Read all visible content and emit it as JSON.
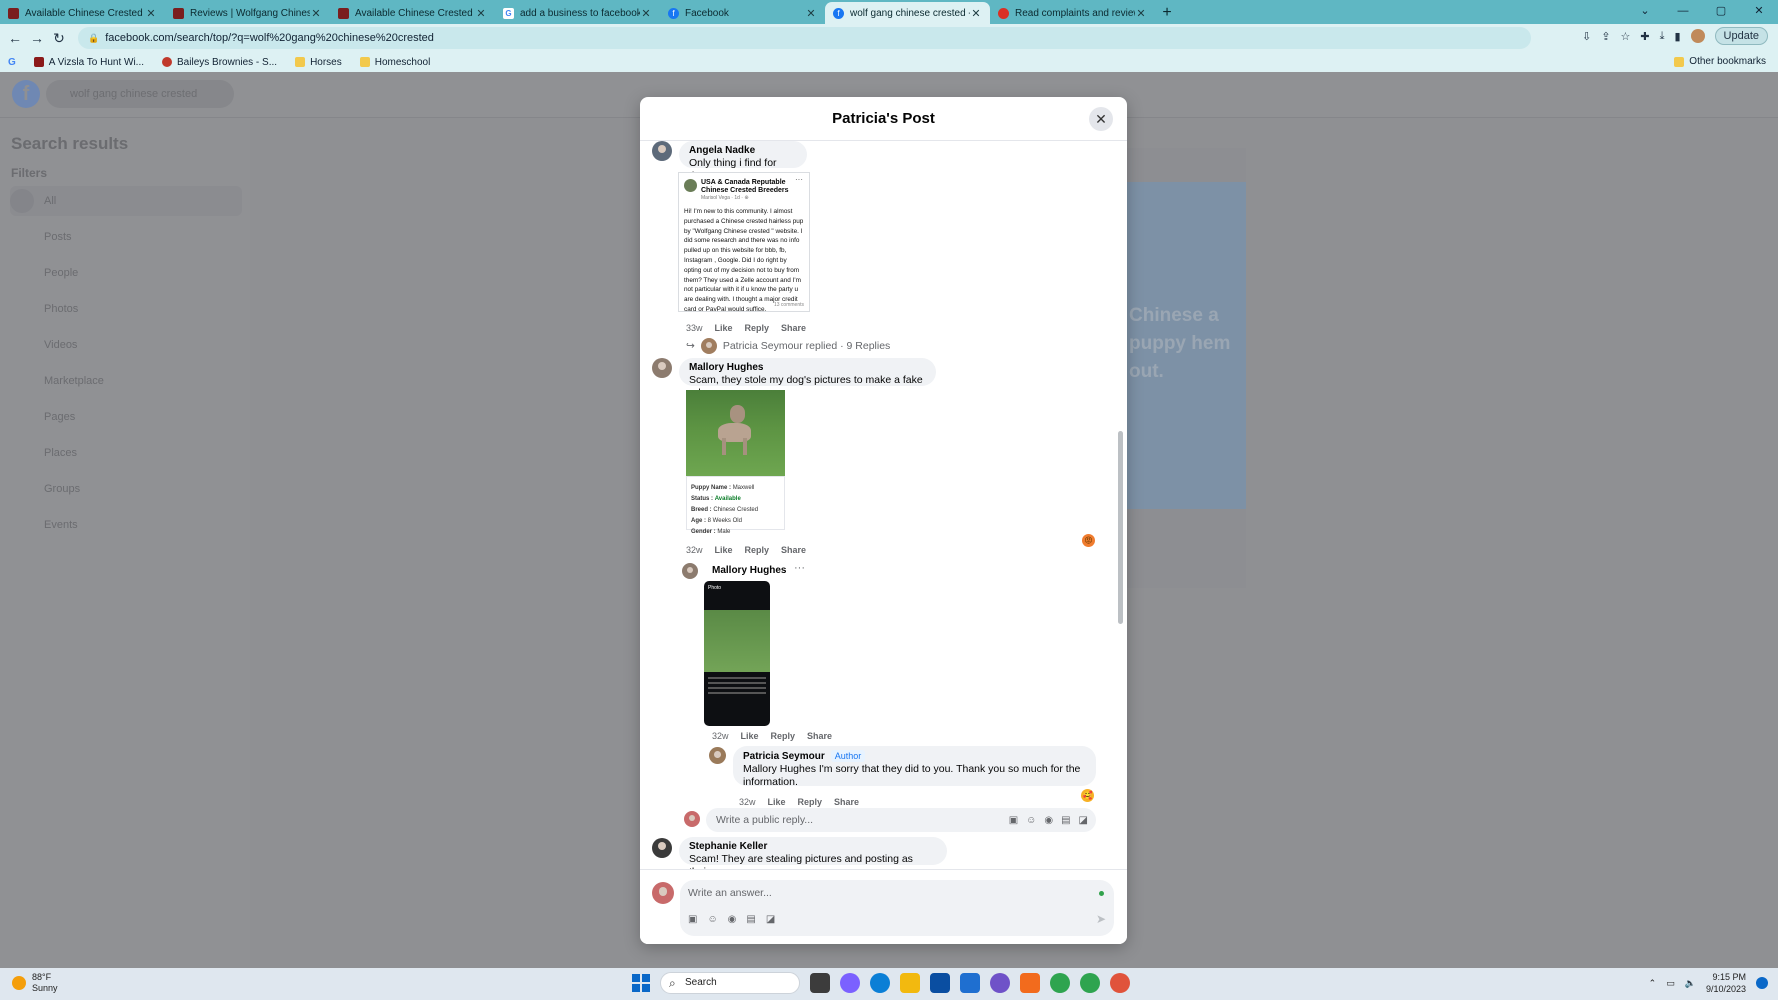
{
  "browser": {
    "tabs": [
      {
        "title": "Available Chinese Crested Puppi",
        "fav_color": "#7a1e1e",
        "active": false
      },
      {
        "title": "Reviews | Wolfgang Chinese Cre",
        "fav_color": "#7a1e1e",
        "active": false
      },
      {
        "title": "Available Chinese Crested Puppi",
        "fav_color": "#7a1e1e",
        "active": false
      },
      {
        "title": "add a business to facebook - Go",
        "fav_color": "#ffffff",
        "active": false
      },
      {
        "title": "Facebook",
        "fav_color": "#1877f2",
        "active": false
      },
      {
        "title": "wolf gang chinese crested - Sear",
        "fav_color": "#1877f2",
        "active": true
      },
      {
        "title": "Read complaints and reviews @",
        "fav_color": "#d93025",
        "active": false
      }
    ],
    "url": "facebook.com/search/top/?q=wolf%20gang%20chinese%20crested",
    "update_label": "Update",
    "bookmarks": [
      {
        "label": "A Vizsla To Hunt Wi...",
        "color": "#8b1a1a"
      },
      {
        "label": "Baileys Brownies - S...",
        "color": "#c0392b"
      },
      {
        "label": "Horses",
        "color": "#f2c94c"
      },
      {
        "label": "Homeschool",
        "color": "#f2c94c"
      }
    ],
    "other_bookmarks": "Other bookmarks"
  },
  "fb": {
    "search_value": "wolf gang chinese crested",
    "side_title": "Search results",
    "filters_label": "Filters",
    "filters": [
      "All",
      "Posts",
      "People",
      "Photos",
      "Videos",
      "Marketplace",
      "Pages",
      "Places",
      "Groups",
      "Events"
    ],
    "ghost_text": "Chinese a puppy hem out."
  },
  "modal": {
    "title": "Patricia's Post",
    "comments": {
      "angela": {
        "name": "Angela Nadke",
        "text": "Only thing i find for them..",
        "time": "33w",
        "shot": {
          "title": "USA & Canada Reputable Chinese Crested Breeders",
          "sub": "Marisol Vega · 1d · ⊕",
          "text": "Hi! I'm new to this community. I almost purchased a Chinese crested hairless pup by \"Wolfgang Chinese crested \" website. I did some research and there was no info pulled up on this website for bbb, fb, Instagram , Google. Did I do right by opting out of my decision not to buy from them? They used a Zelle account and I'm not particular with it if u know the party u are dealing with. I thought a major credit card or PayPal would suffice.",
          "foot": "13 comments"
        },
        "replies_summary": "Patricia Seymour replied · 9 Replies"
      },
      "mallory": {
        "name": "Mallory Hughes",
        "text": "Scam, they stole my dog's pictures to make a fake ad",
        "time": "32w",
        "card": {
          "name_label": "Puppy Name :",
          "name_value": "Maxwell",
          "status_label": "Status :",
          "status_value": "Available",
          "breed_label": "Breed :",
          "breed_value": "Chinese Crested",
          "age_label": "Age :",
          "age_value": "8 Weeks Old",
          "gender_label": "Gender :",
          "gender_value": "Male"
        }
      },
      "mallory_reply": {
        "name": "Mallory Hughes",
        "time": "32w",
        "phone_header": "Photo"
      },
      "patricia_reply": {
        "name": "Patricia Seymour",
        "badge": "Author",
        "text": "Mallory Hughes I'm sorry that they did to you. Thank you so much for the information.",
        "time": "32w"
      },
      "stephanie": {
        "name": "Stephanie Keller",
        "text": "Scam! They are stealing pictures and posting as theirs."
      }
    },
    "actions": {
      "like": "Like",
      "reply": "Reply",
      "share": "Share"
    },
    "public_reply_placeholder": "Write a public reply...",
    "answer_placeholder": "Write an answer..."
  },
  "taskbar": {
    "temp": "88°F",
    "weather": "Sunny",
    "search_label": "Search",
    "time": "9:15 PM",
    "date": "9/10/2023",
    "app_colors": [
      "#3c3c3c",
      "#7b61ff",
      "#0b7fd6",
      "#f2b90f",
      "#0a4ea1",
      "#1f6fd0",
      "#6f52c8",
      "#f26b1d",
      "#2ea44f",
      "#2ea44f",
      "#e0533b"
    ]
  }
}
